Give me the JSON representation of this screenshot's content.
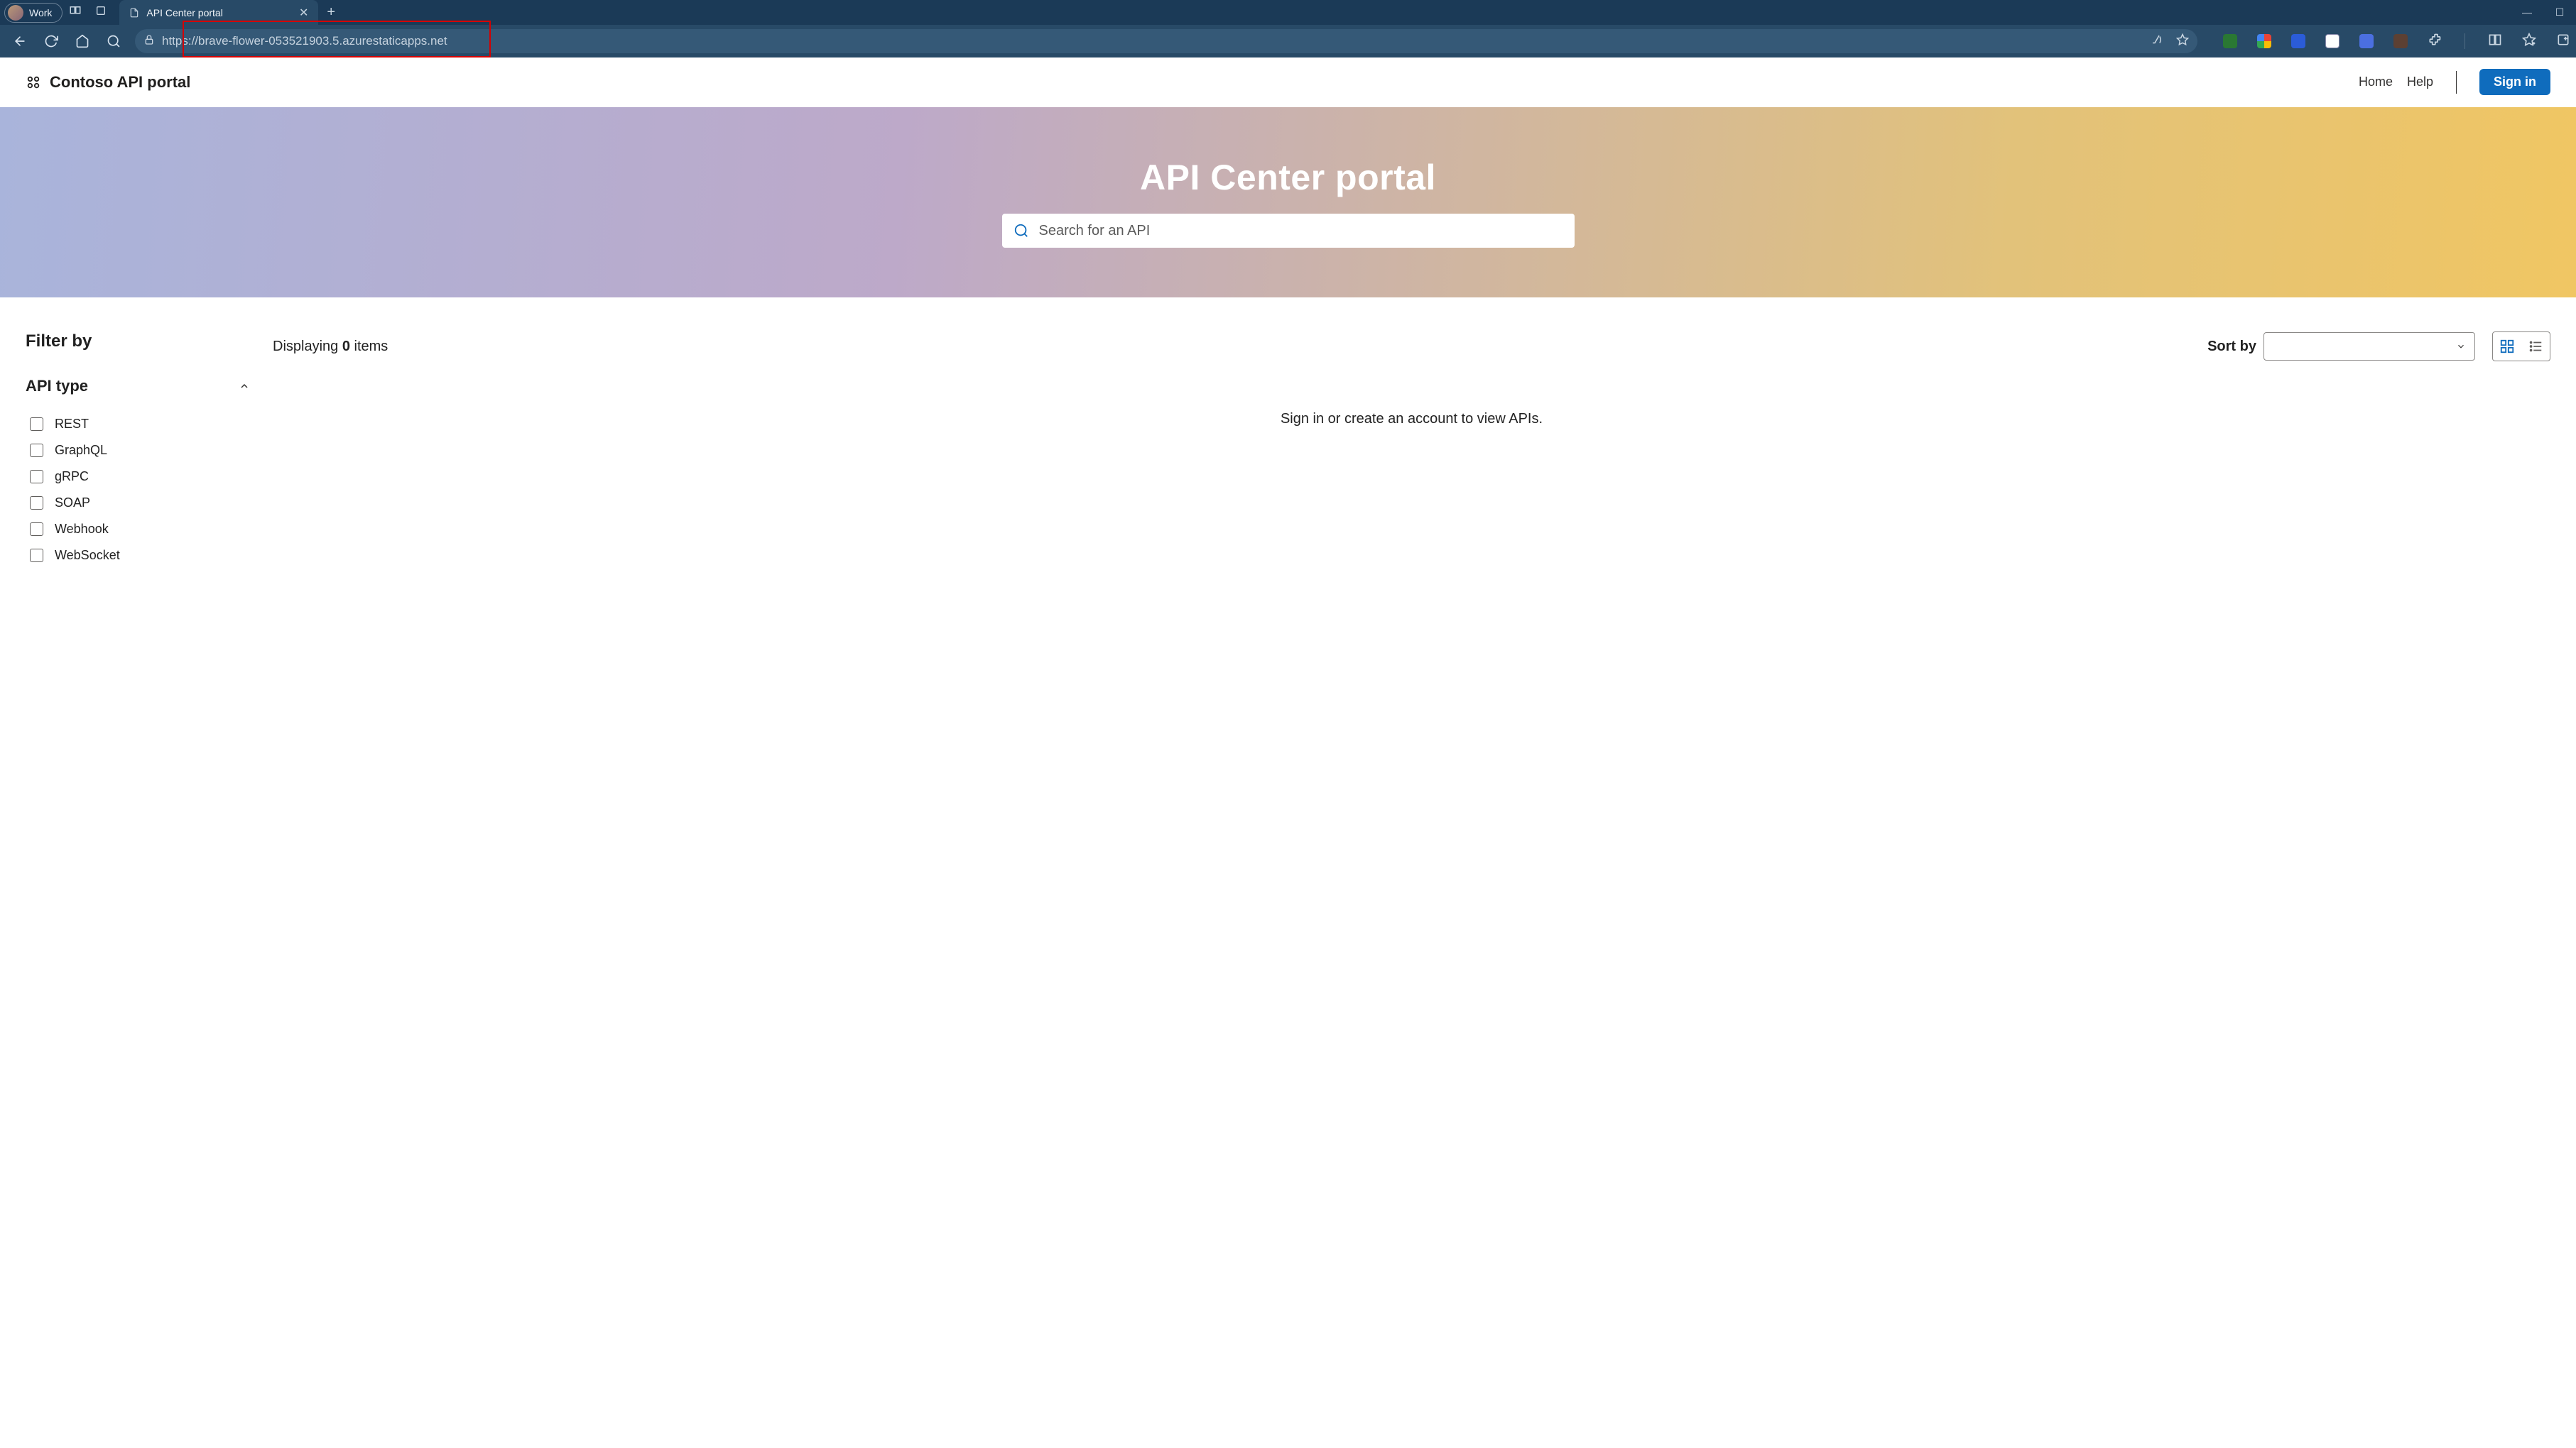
{
  "browser": {
    "profile_label": "Work",
    "tab_title": "API Center portal",
    "url": "https://brave-flower-053521903.5.azurestaticapps.net"
  },
  "page": {
    "brand": "Contoso API portal",
    "nav": {
      "home": "Home",
      "help": "Help",
      "signin": "Sign in"
    },
    "hero": {
      "title": "API Center portal",
      "search_placeholder": "Search for an API"
    },
    "filters": {
      "heading": "Filter by",
      "group_title": "API type",
      "options": [
        "REST",
        "GraphQL",
        "gRPC",
        "SOAP",
        "Webhook",
        "WebSocket"
      ]
    },
    "results": {
      "display_prefix": "Displaying ",
      "display_count": "0",
      "display_suffix": " items",
      "sort_label": "Sort by",
      "empty": "Sign in or create an account to view APIs."
    }
  }
}
